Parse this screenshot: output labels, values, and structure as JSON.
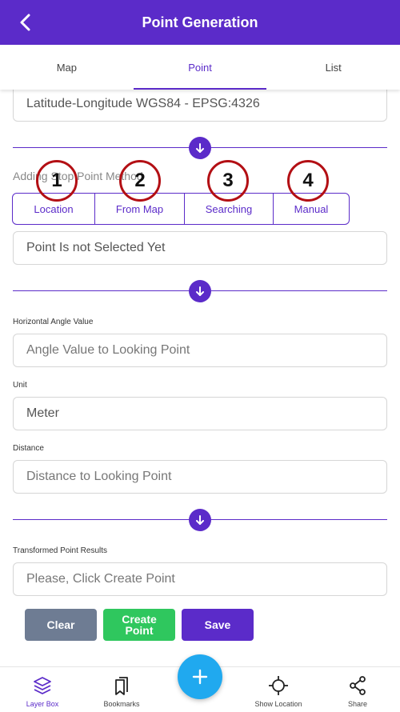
{
  "header": {
    "title": "Point Generation",
    "back_icon": "chevron-left-icon"
  },
  "tabs": [
    {
      "label": "Map",
      "active": false
    },
    {
      "label": "Point",
      "active": true
    },
    {
      "label": "List",
      "active": false
    }
  ],
  "crs_field": {
    "value": "Latitude-Longitude WGS84 - EPSG:4326"
  },
  "method_section": {
    "label": "Adding Stop Point Method",
    "options": [
      "Location",
      "From Map",
      "Searching",
      "Manual"
    ],
    "markers": [
      "1",
      "2",
      "3",
      "4"
    ]
  },
  "selected_point": {
    "value": "Point Is not Selected Yet"
  },
  "horizontal_angle": {
    "label": "Horizontal Angle Value",
    "placeholder": "Angle Value to Looking Point"
  },
  "unit": {
    "label": "Unit",
    "value": "Meter"
  },
  "distance": {
    "label": "Distance",
    "placeholder": "Distance to Looking Point"
  },
  "results": {
    "label": "Transformed Point Results",
    "placeholder": "Please, Click Create Point"
  },
  "actions": {
    "clear_label": "Clear",
    "create_label": "Create Point",
    "save_label": "Save"
  },
  "bottom_nav": {
    "layer_box": "Layer Box",
    "bookmarks": "Bookmarks",
    "show_location": "Show Location",
    "share": "Share"
  },
  "colors": {
    "primary": "#5b2bc9",
    "clear": "#6e7c93",
    "create": "#2fc75e",
    "fab": "#20a9ef",
    "marker": "#b30f14"
  }
}
